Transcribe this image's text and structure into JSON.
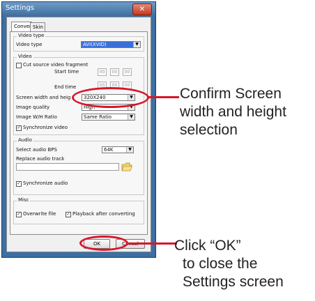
{
  "window": {
    "title": "Settings",
    "close_glyph": "✕"
  },
  "tabs": [
    "Convert",
    "Skin"
  ],
  "video_type_group": {
    "legend": "Video type",
    "label": "Video type",
    "value": "AVI(XVID)"
  },
  "video_group": {
    "legend": "Video",
    "cut_fragment": "Cut source video fragment",
    "start_time": "Start time",
    "end_time": "End time",
    "time_placeholder": "00",
    "screen_size_label": "Screen width and heig",
    "screen_size_value": "320X240",
    "quality_label": "Image quality",
    "quality_value": "High",
    "ratio_label": "Image W/H Ratio",
    "ratio_value": "Same Ratio",
    "sync_video": "Synchronize video"
  },
  "audio_group": {
    "legend": "Audio",
    "bps_label": "Select audio BPS",
    "bps_value": "64K",
    "replace_label": "Replace audio track",
    "sync_audio": "Synchronize audio"
  },
  "misc_group": {
    "legend": "Misc",
    "overwrite": "Overwrite file",
    "playback": "Playback after converting"
  },
  "buttons": {
    "ok": "OK",
    "cancel": "Cancel"
  },
  "annotations": {
    "note1": [
      "Confirm Screen",
      "width and height",
      "selection"
    ],
    "note2": [
      "Click “OK”",
      "to close the",
      "Settings screen"
    ],
    "color": "#d8162b"
  }
}
